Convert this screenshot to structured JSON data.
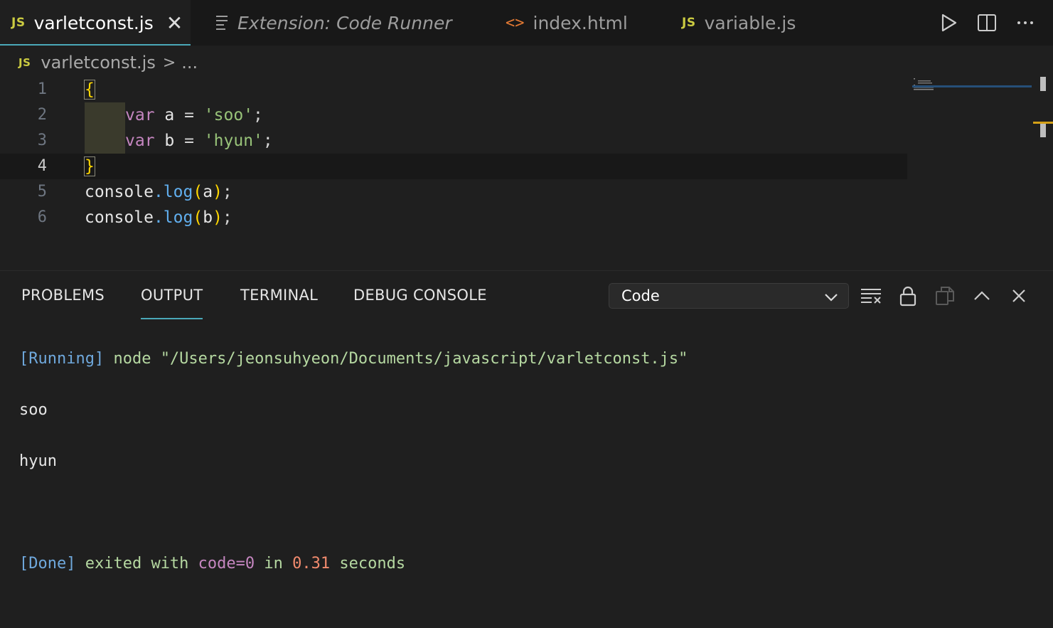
{
  "tabs": [
    {
      "label": "varletconst.js",
      "badge": "JS",
      "active": true,
      "close": "✕"
    },
    {
      "label": "Extension: Code Runner",
      "italic": true
    },
    {
      "label": "index.html",
      "badge": "<>"
    },
    {
      "label": "variable.js",
      "badge": "JS"
    }
  ],
  "breadcrumb": {
    "badge": "JS",
    "file": "varletconst.js",
    "sep": ">",
    "more": "..."
  },
  "editor": {
    "line_numbers": [
      "1",
      "2",
      "3",
      "4",
      "5",
      "6"
    ],
    "lines": [
      {
        "open": "{"
      },
      {
        "kw": "var",
        "name": " a ",
        "eq": "=",
        "str": " 'soo'",
        "end": ";"
      },
      {
        "kw": "var",
        "name": " b ",
        "eq": "=",
        "str": " 'hyun'",
        "end": ";"
      },
      {
        "close": "}"
      },
      {
        "obj": "console",
        "dot": ".",
        "fn": "log",
        "lp": "(",
        "arg": "a",
        "rp": ")",
        "end": ";"
      },
      {
        "obj": "console",
        "dot": ".",
        "fn": "log",
        "lp": "(",
        "arg": "b",
        "rp": ")",
        "end": ";"
      }
    ]
  },
  "panel": {
    "tabs": [
      "PROBLEMS",
      "OUTPUT",
      "TERMINAL",
      "DEBUG CONSOLE"
    ],
    "active_tab": "OUTPUT",
    "channel_select": "Code",
    "output": {
      "running_tag": "[Running]",
      "running_cmd": " node \"/Users/jeonsuhyeon/Documents/javascript/varletconst.js\"",
      "line2": "soo",
      "line3": "hyun",
      "done_tag": "[Done]",
      "done_exited": " exited with ",
      "done_code": "code=0",
      "done_in": " in ",
      "done_time": "0.31",
      "done_seconds": " seconds"
    }
  },
  "colors": {
    "accent": "#4aa8b8",
    "js_badge": "#cbcb41",
    "html_badge": "#e37933",
    "keyword": "#c586c0",
    "bracket": "#ffd700"
  }
}
